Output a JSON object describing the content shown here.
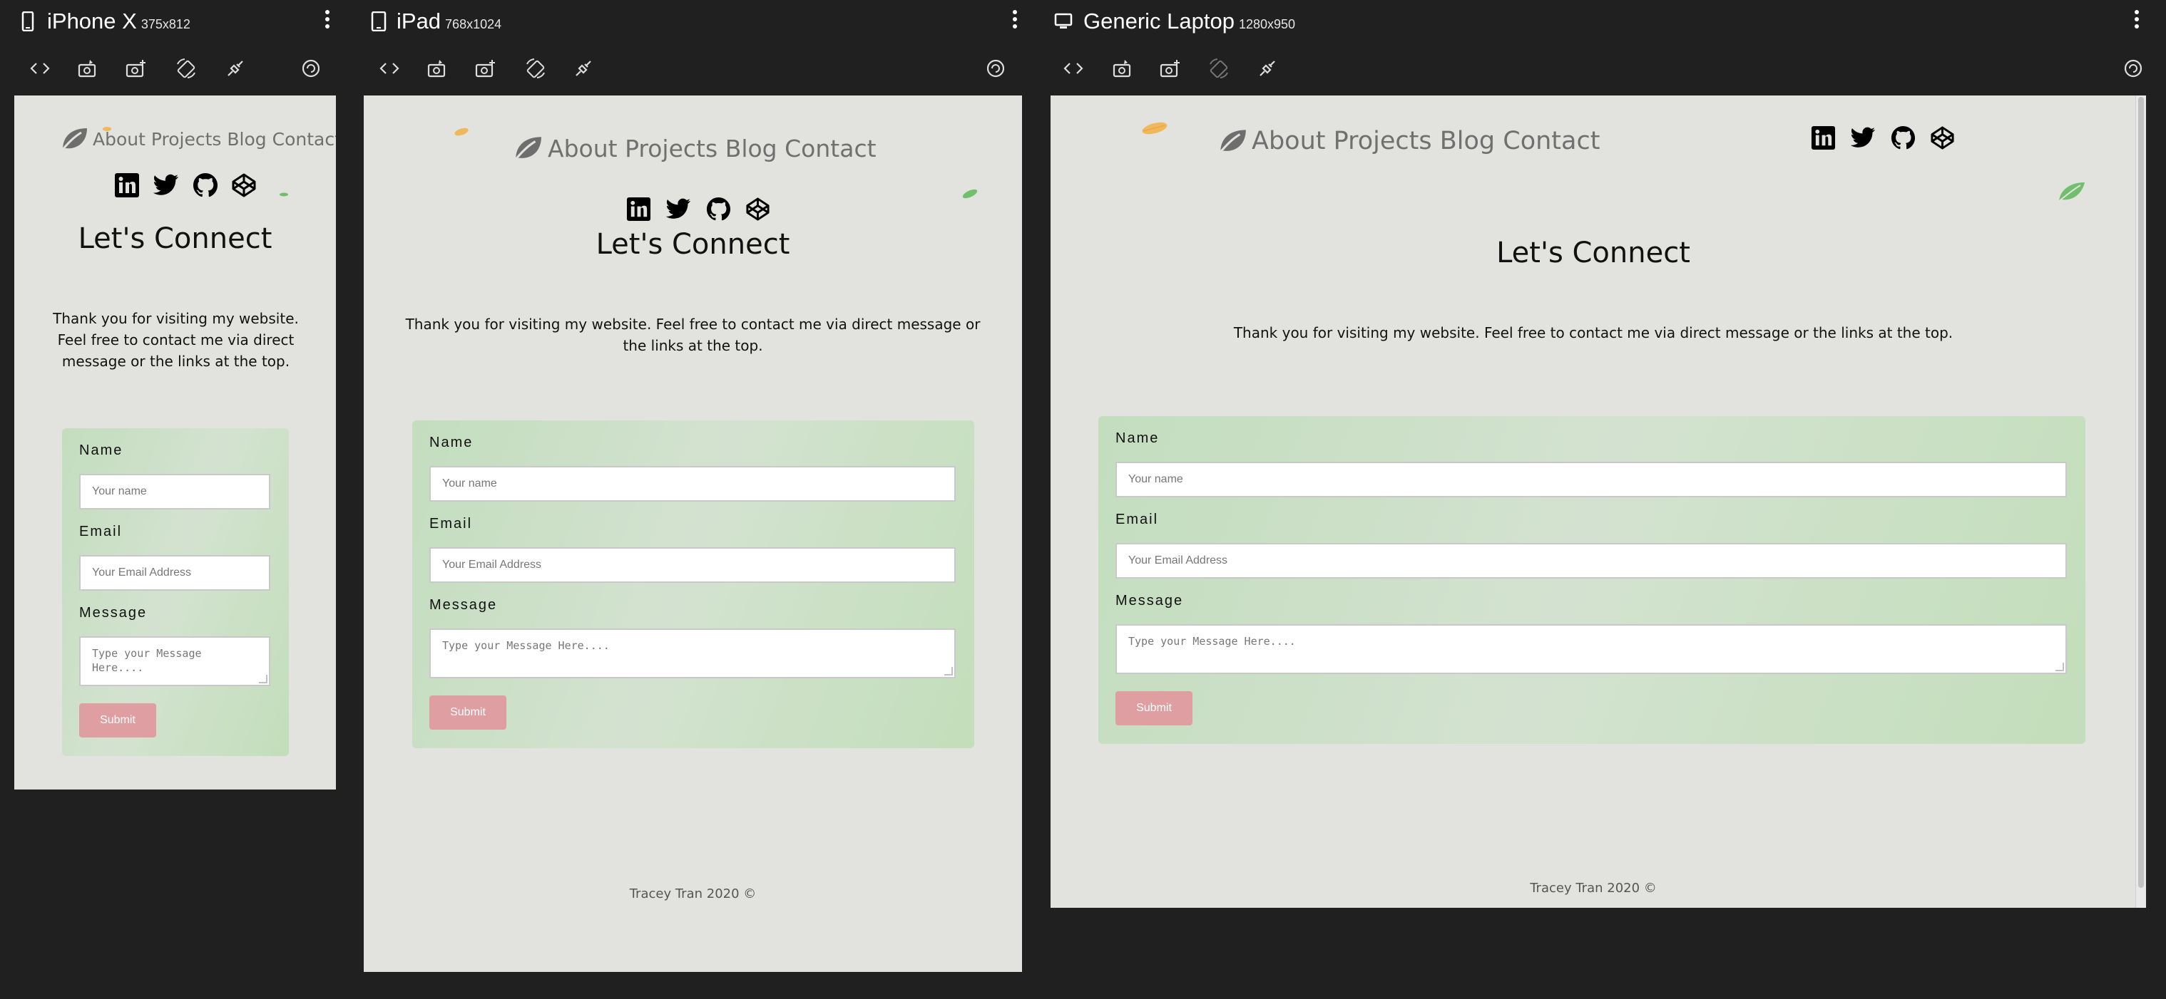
{
  "colors": {
    "background": "#202020",
    "page_background": "#e2e2de",
    "form_gradient": "#c3ddbe",
    "submit_button": "#df9ea1",
    "leaf_orange": "#f0b85a",
    "leaf_green": "#6fbf6c",
    "nav_text": "#707070"
  },
  "devices": [
    {
      "name": "iPhone X",
      "size": "375x812",
      "icon": "mobile-phone-icon"
    },
    {
      "name": "iPad",
      "size": "768x1024",
      "icon": "tablet-icon"
    },
    {
      "name": "Generic Laptop",
      "size": "1280x950",
      "icon": "laptop-icon"
    }
  ],
  "toolbar_icons": [
    "code-icon",
    "screenshot-icon",
    "camera-add-icon",
    "rotate-icon",
    "disconnect-icon",
    "reload-icon"
  ],
  "site": {
    "nav": {
      "about": "About",
      "projects": "Projects",
      "blog": "Blog",
      "contact": "Contact"
    },
    "social_icons": [
      "linkedin-icon",
      "twitter-icon",
      "github-icon",
      "codepen-icon"
    ],
    "heading": "Let's Connect",
    "intro": "Thank you for visiting my website. Feel free to contact me via direct message or the links at the top.",
    "form": {
      "name_label": "Name",
      "name_placeholder": "Your name",
      "email_label": "Email",
      "email_placeholder": "Your Email Address",
      "message_label": "Message",
      "message_placeholder": "Type your Message Here....",
      "submit_label": "Submit"
    },
    "footer": "Tracey Tran 2020 ©"
  }
}
